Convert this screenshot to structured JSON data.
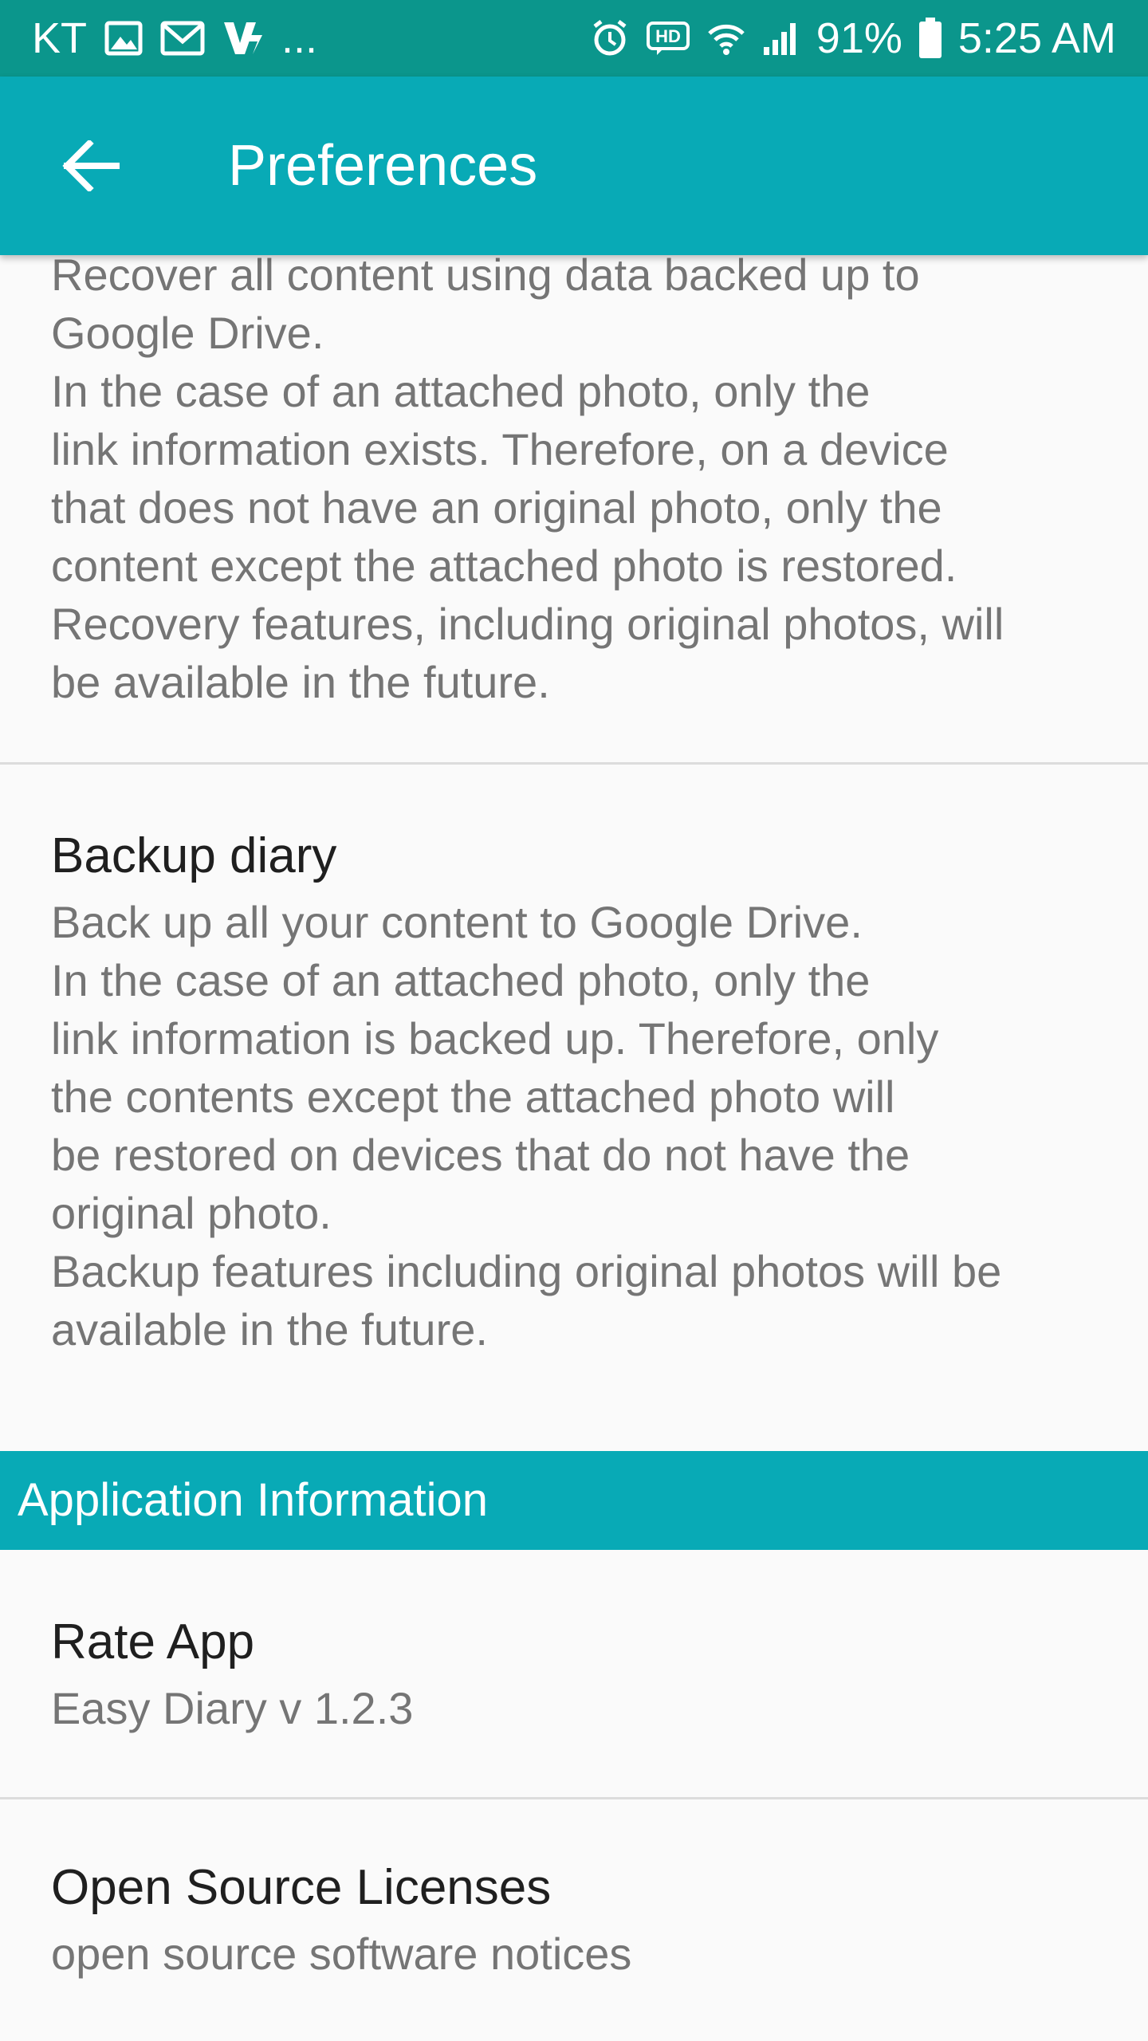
{
  "status_bar": {
    "carrier": "KT",
    "more": "...",
    "hd_badge": "HD",
    "battery_percent": "91%",
    "time": "5:25 AM",
    "icons": [
      "image-icon",
      "mail-icon",
      "v-app-icon",
      "alarm-icon",
      "hd-icon",
      "wifi-icon",
      "signal-icon",
      "battery-icon"
    ]
  },
  "app_bar": {
    "title": "Preferences",
    "back_icon": "arrow-left-icon",
    "color": "#08aab6"
  },
  "restore_item": {
    "summary": "Recover all content using data backed up to Google Drive.\nIn the case of an attached photo, only the\nlink information exists. Therefore, on a device that does not have an original photo, only the content except the attached photo is restored.\nRecovery features, including original photos, will be available in the future."
  },
  "backup_item": {
    "title": "Backup diary",
    "summary": "Back up all your content to Google Drive.\nIn the case of an attached photo, only the\nlink information is backed up. Therefore, only the contents except the attached photo will be restored on devices that do not have the original photo.\nBackup features including original photos will be available in the future."
  },
  "section_app_info": {
    "header": "Application Information"
  },
  "rate_item": {
    "title": "Rate App",
    "summary": "Easy Diary v 1.2.3"
  },
  "oss_item": {
    "title": "Open Source Licenses",
    "summary": "open source software notices"
  },
  "colors": {
    "status_bar": "#0b968c",
    "accent": "#08aab6",
    "background": "#fafafa",
    "summary_text": "#757575",
    "title_text": "#1f1f1f"
  }
}
